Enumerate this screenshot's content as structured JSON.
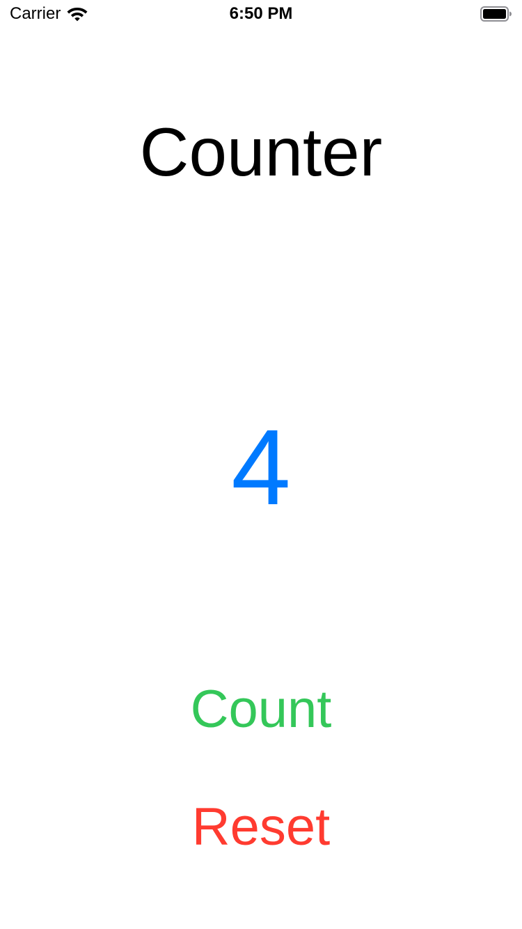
{
  "status_bar": {
    "carrier": "Carrier",
    "time": "6:50 PM",
    "wifi_icon": "wifi-icon",
    "battery_icon": "battery-full-icon"
  },
  "screen": {
    "title": "Counter",
    "count_value": "4",
    "count_button_label": "Count",
    "reset_button_label": "Reset"
  },
  "colors": {
    "count_value": "#007aff",
    "count_button": "#34c759",
    "reset_button": "#ff3b30"
  }
}
